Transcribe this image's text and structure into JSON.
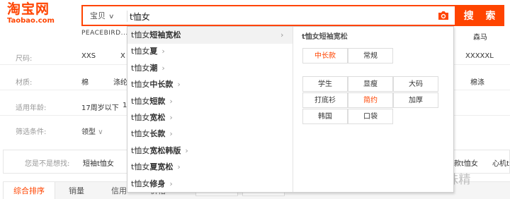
{
  "logo": {
    "cn": "淘宝网",
    "en": "Taobao.com"
  },
  "search": {
    "type_label": "宝贝",
    "query": "t恤女",
    "button_label": "搜 索"
  },
  "filters": {
    "top_cut_text": "PEACEBIRD...",
    "top_right_cut": "森马",
    "rows": [
      {
        "label": "尺码:",
        "values": [
          "XXS",
          "X"
        ],
        "right": "XXXXXL"
      },
      {
        "label": "材质:",
        "values": [
          "棉",
          "涤纶"
        ],
        "right": "棉涤"
      },
      {
        "label": "适用年龄:",
        "values": [
          "17周岁以下",
          "1"
        ],
        "right": ""
      },
      {
        "label": "筛选条件:",
        "values": [
          "领型"
        ],
        "right": ""
      }
    ]
  },
  "suggest_bar": {
    "label": "您是不是想找:",
    "first": "短袖t恤女",
    "right_items": [
      "款t恤女",
      "心机t"
    ]
  },
  "sort_bar": {
    "tabs": [
      "综合排序",
      "销量",
      "信用",
      "价格"
    ]
  },
  "dropdown": {
    "items": [
      {
        "prefix": "t恤女",
        "suffix": "短袖宽松",
        "hover": true
      },
      {
        "prefix": "t恤女",
        "suffix": "夏"
      },
      {
        "prefix": "t恤女",
        "suffix": "潮"
      },
      {
        "prefix": "t恤女",
        "suffix": "中长款"
      },
      {
        "prefix": "t恤女",
        "suffix": "短款"
      },
      {
        "prefix": "t恤女",
        "suffix": "宽松"
      },
      {
        "prefix": "t恤女",
        "suffix": "长款"
      },
      {
        "prefix": "t恤女",
        "suffix": "宽松韩版"
      },
      {
        "prefix": "t恤女",
        "suffix": "夏宽松"
      },
      {
        "prefix": "t恤女",
        "suffix": "修身"
      }
    ],
    "panel_title": "t恤女短袖宽松",
    "panel_group1": [
      "中长款",
      "常规"
    ],
    "panel_group2": [
      "学生",
      "显瘦",
      "大码",
      "打底衫",
      "简约",
      "加厚",
      "韩国",
      "口袋"
    ]
  },
  "watermark": "知乎 @一粒味精",
  "colors": {
    "accent": "#ff4400"
  }
}
